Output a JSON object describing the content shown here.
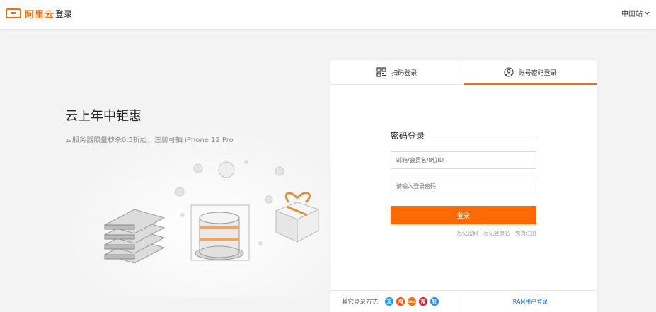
{
  "header": {
    "logo_text": "阿里云",
    "title": "登录",
    "region": "中国站",
    "region_icon": "chevron-down-icon"
  },
  "promo": {
    "title": "云上年中钜惠",
    "subtitle": "云服务器限量秒杀0.5折起，注册可抽 iPhone 12 Pro"
  },
  "login": {
    "tabs": [
      {
        "label": "扫码登录",
        "icon": "qr-code-icon"
      },
      {
        "label": "账号密码登录",
        "icon": "user-icon",
        "active": true
      }
    ],
    "form_title": "密码登录",
    "username_placeholder": "邮箱/会员名/8位ID",
    "password_placeholder": "请输入登录密码",
    "submit_label": "登录",
    "links": [
      "忘记密码",
      "忘记登录名",
      "免费注册"
    ],
    "other_login_label": "其它登录方式",
    "social": [
      {
        "name": "alipay-icon",
        "glyph": "支",
        "color": "#1a9bf0"
      },
      {
        "name": "taobao-icon",
        "glyph": "淘",
        "color": "#ff5000"
      },
      {
        "name": "1688-icon",
        "glyph": "1688",
        "color": "#ff6a00"
      },
      {
        "name": "weibo-icon",
        "glyph": "微",
        "color": "#e6162d"
      },
      {
        "name": "dingtalk-icon",
        "glyph": "钉",
        "color": "#1e8cf0"
      }
    ],
    "ram_label": "RAM用户登录"
  },
  "colors": {
    "accent": "#ff6a00",
    "link": "#1a73c8"
  }
}
